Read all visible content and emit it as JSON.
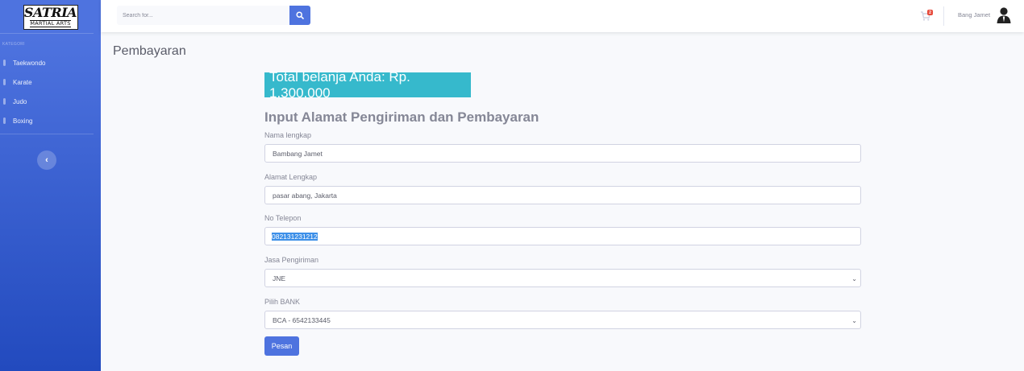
{
  "brand": {
    "logo_line1": "SATRIA",
    "logo_line2": "MARTIAL ARTS"
  },
  "sidebar": {
    "heading": "KATEGORI",
    "items": [
      {
        "label": "Taekwondo"
      },
      {
        "label": "Karate"
      },
      {
        "label": "Judo"
      },
      {
        "label": "Boxing"
      }
    ],
    "toggle_icon": "chevron-left-icon"
  },
  "topbar": {
    "search_placeholder": "Search for...",
    "cart_count": "2",
    "username": "Bang Jamet"
  },
  "page": {
    "title": "Pembayaran",
    "total_text": "Total belanja Anda: Rp. 1.300.000",
    "form_heading": "Input Alamat Pengiriman dan Pembayaran"
  },
  "form": {
    "name_label": "Nama lengkap",
    "name_value": "Bambang Jamet",
    "address_label": "Alamat Lengkap",
    "address_value": "pasar abang, Jakarta",
    "phone_label": "No Telepon",
    "phone_value": "082131231212",
    "shipping_label": "Jasa Pengiriman",
    "shipping_value": "JNE",
    "bank_label": "Pilih BANK",
    "bank_value": "BCA - 6542133445",
    "submit_label": "Pesan"
  },
  "colors": {
    "primary": "#4e73df",
    "info": "#36b9cc",
    "danger": "#e74a3b",
    "selection": "#3c8fe8"
  }
}
